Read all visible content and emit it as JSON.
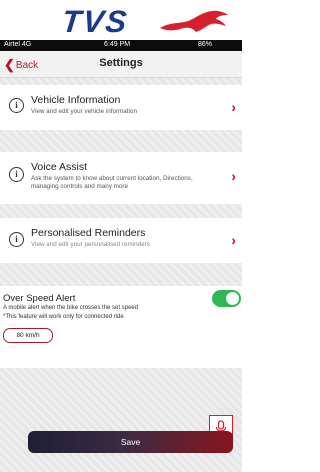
{
  "brand": {
    "logo_text": "TVS"
  },
  "status_bar": {
    "carrier": "Airtel 4G",
    "time": "6:49 PM",
    "battery": "86%"
  },
  "nav": {
    "back_label": "Back",
    "title": "Settings"
  },
  "settings": [
    {
      "title": "Vehicle Information",
      "description": "View and edit your vehicle information"
    },
    {
      "title": "Voice Assist",
      "description": "Ask the system to know about current location, Directions, managing controls and many more"
    },
    {
      "title": "Personalised Reminders",
      "description": "View and edit your personalised reminders"
    }
  ],
  "over_speed": {
    "title": "Over Speed Alert",
    "line1": "A mobile alert when the bike crosses the set speed",
    "line2": "*This feature will work only for connected ride",
    "speed_value": "80 km/h",
    "enabled": true
  },
  "save_label": "Save",
  "colors": {
    "accent": "#c8102e",
    "toggle_on": "#2fb84f",
    "brand_blue": "#1b3a8c"
  },
  "icons": [
    "info-icon",
    "chevron-right-icon",
    "chevron-left-icon",
    "mic-icon",
    "horse-logo-icon"
  ]
}
